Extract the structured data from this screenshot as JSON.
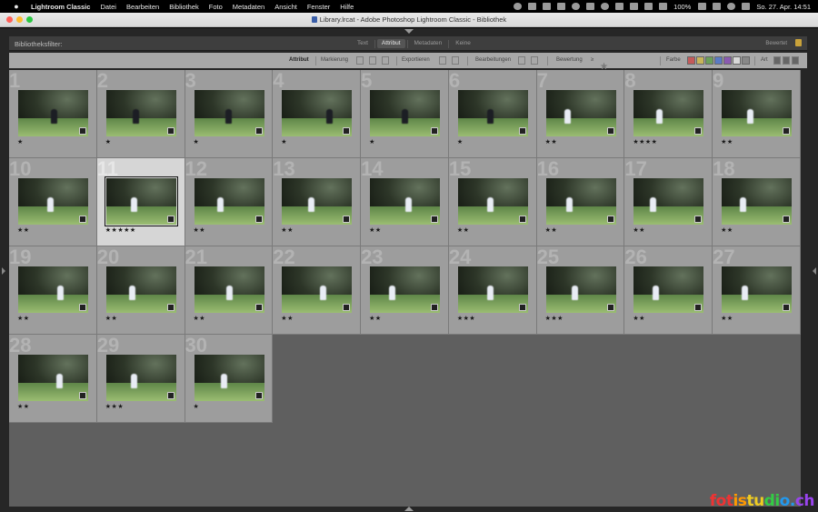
{
  "menubar": {
    "app_name": "Lightroom Classic",
    "items": [
      "Datei",
      "Bearbeiten",
      "Bibliothek",
      "Foto",
      "Metadaten",
      "Ansicht",
      "Fenster",
      "Hilfe"
    ],
    "battery": "100%",
    "datetime": "So. 27. Apr.  14:51"
  },
  "window": {
    "title": "Library.lrcat - Adobe Photoshop Lightroom Classic - Bibliothek"
  },
  "filter_bar": {
    "label": "Bibliotheksfilter:",
    "tabs": [
      "Text",
      "Attribut",
      "Metadaten",
      "Keine"
    ],
    "active_tab": "Attribut",
    "preset": "Bewertet"
  },
  "attribute_bar": {
    "attribute": "Attribut",
    "flag": "Markierung",
    "export": "Exportieren",
    "edits": "Bearbeitungen",
    "rating": "Bewertung",
    "rating_op": "≥",
    "rating_value": 1,
    "color": "Farbe",
    "kind": "Art",
    "color_swatches": [
      "#c45a5a",
      "#c8b55a",
      "#6aa05a",
      "#5a7ac4",
      "#8a5ab0",
      "#d8d8d8",
      "#888888"
    ]
  },
  "grid": {
    "selected_index": 11,
    "cells": [
      {
        "index": "1",
        "rating": "★",
        "figure": "dark",
        "fx": 0.52
      },
      {
        "index": "2",
        "rating": "★",
        "figure": "dark",
        "fx": 0.42
      },
      {
        "index": "3",
        "rating": "★",
        "figure": "dark",
        "fx": 0.48
      },
      {
        "index": "4",
        "rating": "★",
        "figure": "dark",
        "fx": 0.7
      },
      {
        "index": "5",
        "rating": "★",
        "figure": "dark",
        "fx": 0.5
      },
      {
        "index": "6",
        "rating": "★",
        "figure": "dark",
        "fx": 0.45
      },
      {
        "index": "7",
        "rating": "★★",
        "figure": "white",
        "fx": 0.28
      },
      {
        "index": "8",
        "rating": "★★★★",
        "figure": "white",
        "fx": 0.35
      },
      {
        "index": "9",
        "rating": "★★",
        "figure": "white",
        "fx": 0.4
      },
      {
        "index": "10",
        "rating": "★★",
        "figure": "white",
        "fx": 0.45
      },
      {
        "index": "11",
        "rating": "★★★★★",
        "figure": "white",
        "fx": 0.38
      },
      {
        "index": "12",
        "rating": "★★",
        "figure": "white",
        "fx": 0.35
      },
      {
        "index": "13",
        "rating": "★★",
        "figure": "white",
        "fx": 0.42
      },
      {
        "index": "14",
        "rating": "★★",
        "figure": "white",
        "fx": 0.55
      },
      {
        "index": "15",
        "rating": "★★",
        "figure": "white",
        "fx": 0.46
      },
      {
        "index": "16",
        "rating": "★★",
        "figure": "white",
        "fx": 0.32
      },
      {
        "index": "17",
        "rating": "★★",
        "figure": "white",
        "fx": 0.25
      },
      {
        "index": "18",
        "rating": "★★",
        "figure": "white",
        "fx": 0.28
      },
      {
        "index": "19",
        "rating": "★★",
        "figure": "white",
        "fx": 0.62
      },
      {
        "index": "20",
        "rating": "★★",
        "figure": "white",
        "fx": 0.35
      },
      {
        "index": "21",
        "rating": "★★",
        "figure": "white",
        "fx": 0.5
      },
      {
        "index": "22",
        "rating": "★★",
        "figure": "white",
        "fx": 0.6
      },
      {
        "index": "23",
        "rating": "★★",
        "figure": "white",
        "fx": 0.3
      },
      {
        "index": "24",
        "rating": "★★★",
        "figure": "white",
        "fx": 0.45
      },
      {
        "index": "25",
        "rating": "★★★",
        "figure": "white",
        "fx": 0.4
      },
      {
        "index": "26",
        "rating": "★★",
        "figure": "white",
        "fx": 0.3
      },
      {
        "index": "27",
        "rating": "★★",
        "figure": "white",
        "fx": 0.32
      },
      {
        "index": "28",
        "rating": "★★",
        "figure": "white",
        "fx": 0.6
      },
      {
        "index": "29",
        "rating": "★★★",
        "figure": "white",
        "fx": 0.38
      },
      {
        "index": "30",
        "rating": "★",
        "figure": "white",
        "fx": 0.42
      }
    ]
  },
  "watermark": {
    "text": "fotistudio.ch"
  }
}
